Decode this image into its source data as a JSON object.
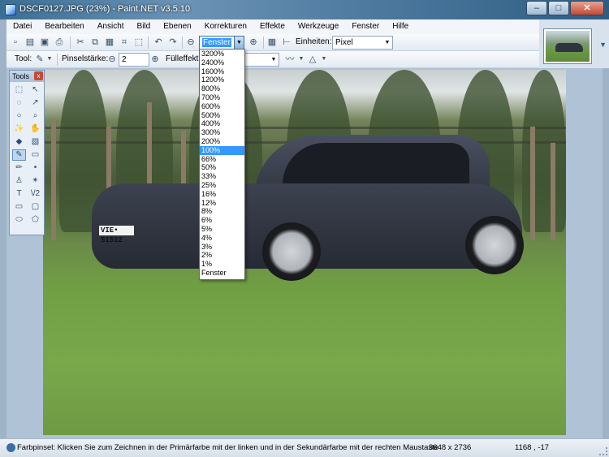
{
  "window": {
    "title": "DSCF0127.JPG (23%) - Paint.NET v3.5.10",
    "minimize": "–",
    "maximize": "□",
    "close": "✕"
  },
  "menu": [
    "Datei",
    "Bearbeiten",
    "Ansicht",
    "Bild",
    "Ebenen",
    "Korrekturen",
    "Effekte",
    "Werkzeuge",
    "Fenster",
    "Hilfe"
  ],
  "toolbar": {
    "zoom_value": "Fenster",
    "units_label": "Einheiten:",
    "units_value": "Pixel",
    "tool_label": "Tool:",
    "brush_width_label": "Pinselstärke:",
    "brush_width_value": "2",
    "fill_label": "Fülleffekt"
  },
  "tools_window": {
    "title": "Tools",
    "close": "x",
    "tools": [
      {
        "icon": "rectangle-select-icon",
        "glyph": "⬚"
      },
      {
        "icon": "move-selection-icon",
        "glyph": "↖"
      },
      {
        "icon": "lasso-select-icon",
        "glyph": "◌"
      },
      {
        "icon": "move-selected-icon",
        "glyph": "↗"
      },
      {
        "icon": "ellipse-select-icon",
        "glyph": "○"
      },
      {
        "icon": "zoom-icon",
        "glyph": "⌕"
      },
      {
        "icon": "magic-wand-icon",
        "glyph": "✨"
      },
      {
        "icon": "pan-hand-icon",
        "glyph": "✋"
      },
      {
        "icon": "paint-bucket-icon",
        "glyph": "◆"
      },
      {
        "icon": "gradient-icon",
        "glyph": "▧"
      },
      {
        "icon": "paintbrush-icon",
        "glyph": "✎"
      },
      {
        "icon": "eraser-icon",
        "glyph": "▭"
      },
      {
        "icon": "pencil-icon",
        "glyph": "✏"
      },
      {
        "icon": "color-picker-icon",
        "glyph": "•"
      },
      {
        "icon": "clone-stamp-icon",
        "glyph": "♙"
      },
      {
        "icon": "recolor-icon",
        "glyph": "✴"
      },
      {
        "icon": "text-icon",
        "glyph": "T"
      },
      {
        "icon": "line-curve-icon",
        "glyph": "\\/2"
      },
      {
        "icon": "rectangle-shape-icon",
        "glyph": "▭"
      },
      {
        "icon": "rounded-rectangle-icon",
        "glyph": "▢"
      },
      {
        "icon": "ellipse-shape-icon",
        "glyph": "⬭"
      },
      {
        "icon": "freeform-shape-icon",
        "glyph": "⬠"
      }
    ],
    "active_index": 10
  },
  "zoom_dropdown": {
    "options": [
      "3200%",
      "2400%",
      "1600%",
      "1200%",
      "800%",
      "700%",
      "600%",
      "500%",
      "400%",
      "300%",
      "200%",
      "100%",
      "66%",
      "50%",
      "33%",
      "25%",
      "16%",
      "12%",
      "8%",
      "6%",
      "5%",
      "4%",
      "3%",
      "2%",
      "1%",
      "Fenster"
    ],
    "selected": "100%"
  },
  "canvas": {
    "plate_text": "VIE• 51512"
  },
  "status": {
    "hint": "Farbpinsel: Klicken Sie zum Zeichnen in der Primärfarbe mit der linken und in der Sekundärfarbe mit der rechten Maustaste",
    "image_size": "3648 x 2736",
    "cursor_pos": "1168 , -17"
  }
}
